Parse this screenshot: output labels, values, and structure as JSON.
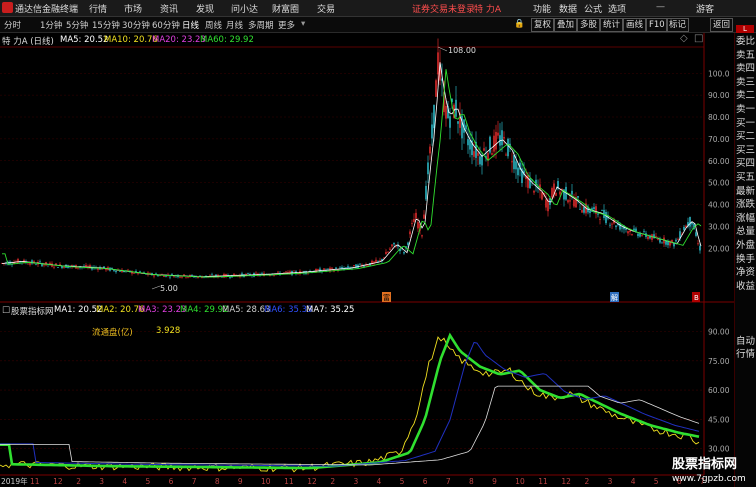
{
  "app": {
    "title": "通达信金融终端",
    "menu": [
      "行情",
      "市场",
      "资讯",
      "发现",
      "问小达",
      "财富圈",
      "交易"
    ],
    "warning": "证券交易未登录",
    "stock_name": "特 力A",
    "right_menu": [
      "功能",
      "数据",
      "公式",
      "选项"
    ],
    "guest": "游客"
  },
  "toolbar": {
    "periods": [
      "分时",
      "1分钟",
      "5分钟",
      "15分钟",
      "30分钟",
      "60分钟",
      "日线",
      "周线",
      "月线",
      "多周期",
      "更多"
    ],
    "active": "日线",
    "right_buttons": [
      "复权",
      "叠加",
      "多股",
      "统计",
      "画线",
      "F10",
      "标记",
      "返回"
    ],
    "lock_icon": "lock-icon"
  },
  "main_panel": {
    "stock_label": "特 力A (日线)",
    "ma": [
      {
        "label": "MA5: 20.52",
        "color": "#ffffff"
      },
      {
        "label": "MA10: 20.76",
        "color": "#f0e020"
      },
      {
        "label": "MA20: 23.23",
        "color": "#e040e0"
      },
      {
        "label": "MA60: 29.92",
        "color": "#30e030"
      }
    ],
    "high_label": "108.00",
    "low_label": "5.00",
    "y_ticks": [
      "100.0",
      "90.00",
      "80.00",
      "70.00",
      "60.00",
      "50.00",
      "40.00",
      "30.00",
      "20.00"
    ],
    "marker_left": "富",
    "marker_mid": "解",
    "marker_right": "B"
  },
  "sub_panel": {
    "title": "股票指标网",
    "ma": [
      {
        "label": "MA1: 20.52",
        "color": "#ffffff"
      },
      {
        "label": "MA2: 20.76",
        "color": "#f0e020"
      },
      {
        "label": "MA3: 23.23",
        "color": "#e040e0"
      },
      {
        "label": "MA4: 29.92",
        "color": "#30e030"
      },
      {
        "label": "MA5: 28.63",
        "color": "#cfcfcf"
      },
      {
        "label": "MA6: 35.33",
        "color": "#3050ff"
      },
      {
        "label": "MA7: 35.25",
        "color": "#ffffff"
      }
    ],
    "float_label": "流通盘(亿)",
    "float_value": "3.928",
    "y_ticks": [
      "90.00",
      "75.00",
      "60.00",
      "45.00",
      "30.00"
    ]
  },
  "x_axis": {
    "year_label": "2019年",
    "ticks": [
      "11",
      "12",
      "2",
      "3",
      "4",
      "5",
      "6",
      "7",
      "8",
      "9",
      "10",
      "11",
      "12",
      "2",
      "3",
      "4",
      "5",
      "6",
      "7",
      "8",
      "9",
      "10",
      "11",
      "12",
      "2",
      "3",
      "4",
      "5",
      "6",
      "7"
    ]
  },
  "right_panel": {
    "top_badge": "L",
    "items": [
      "委比",
      "卖五",
      "卖四",
      "卖三",
      "卖二",
      "卖一",
      "买一",
      "买二",
      "买三",
      "买四",
      "买五",
      "最新",
      "涨跌",
      "涨幅",
      "总量",
      "外盘",
      "换手",
      "净资",
      "收益"
    ],
    "lower_items": [
      "自动",
      "行情"
    ]
  },
  "watermark": {
    "line1": "股票指标网",
    "line2": "www.7gpzb.com"
  }
}
